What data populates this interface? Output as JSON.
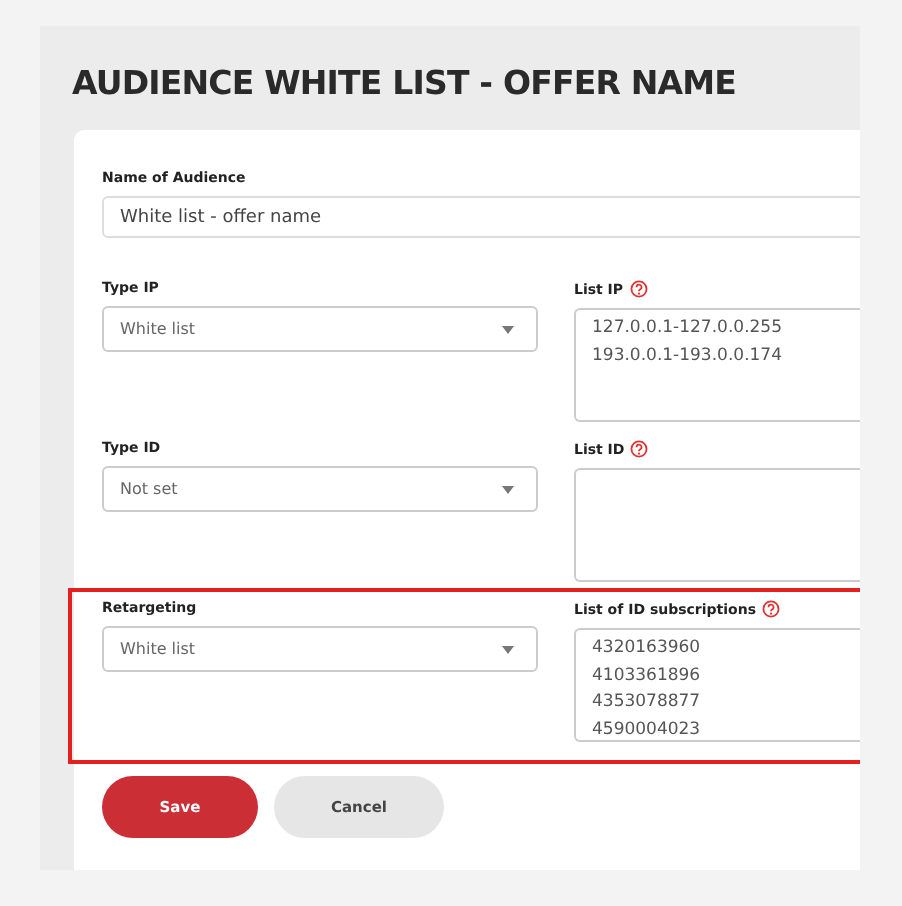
{
  "title": "AUDIENCE WHITE LIST - OFFER NAME",
  "name_field": {
    "label": "Name of Audience",
    "value": "White list - offer name"
  },
  "rows": [
    {
      "highlighted": false,
      "select": {
        "label": "Type IP",
        "value": "White list"
      },
      "list": {
        "label": "List IP",
        "lines": [
          "127.0.0.1-127.0.0.255",
          "193.0.0.1-193.0.0.174"
        ]
      }
    },
    {
      "highlighted": false,
      "select": {
        "label": "Type ID",
        "value": "Not set"
      },
      "list": {
        "label": "List ID"
      }
    },
    {
      "highlighted": true,
      "select": {
        "label": "Retargeting",
        "value": "White list"
      },
      "list": {
        "label": "List of ID subscriptions",
        "lines": [
          "4320163960",
          "4103361896",
          "4353078877",
          "4590004023"
        ]
      }
    }
  ],
  "buttons": [
    {
      "kind": "primary",
      "label": "Save"
    },
    {
      "kind": "secondary",
      "label": "Cancel"
    }
  ]
}
